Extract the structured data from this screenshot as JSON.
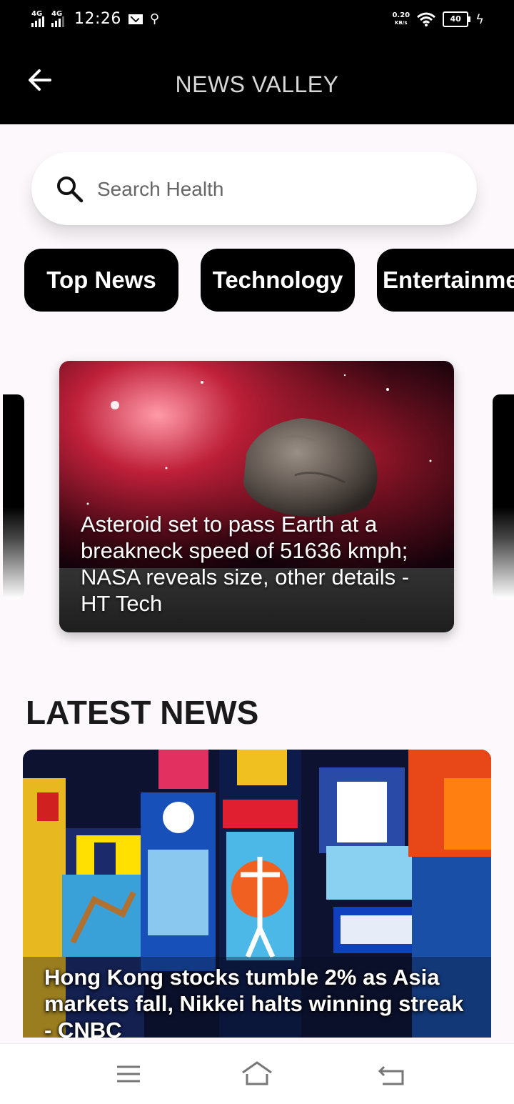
{
  "status_bar": {
    "signal_1": "4G",
    "signal_2": "4G",
    "time": "12:26",
    "speed_value": "0.20",
    "speed_unit": "KB/s",
    "battery": "40"
  },
  "app_bar": {
    "title": "NEWS VALLEY",
    "back_icon": "arrow-left-icon"
  },
  "search": {
    "placeholder": "Search Health",
    "value": "",
    "icon": "search-icon"
  },
  "categories": [
    {
      "label": "Top News"
    },
    {
      "label": "Technology"
    },
    {
      "label": "Entertainment"
    }
  ],
  "featured": {
    "title": "Asteroid set to pass Earth at a breakneck speed of 51636 kmph; NASA reveals size, other details - HT Tech"
  },
  "latest": {
    "heading": "LATEST NEWS",
    "items": [
      {
        "title": "Hong Kong stocks tumble 2% as Asia markets fall, Nikkei halts winning streak - CNBC"
      }
    ]
  },
  "nav_bar": {
    "menu_icon": "menu-icon",
    "home_icon": "home-icon",
    "back_icon": "back-icon"
  }
}
